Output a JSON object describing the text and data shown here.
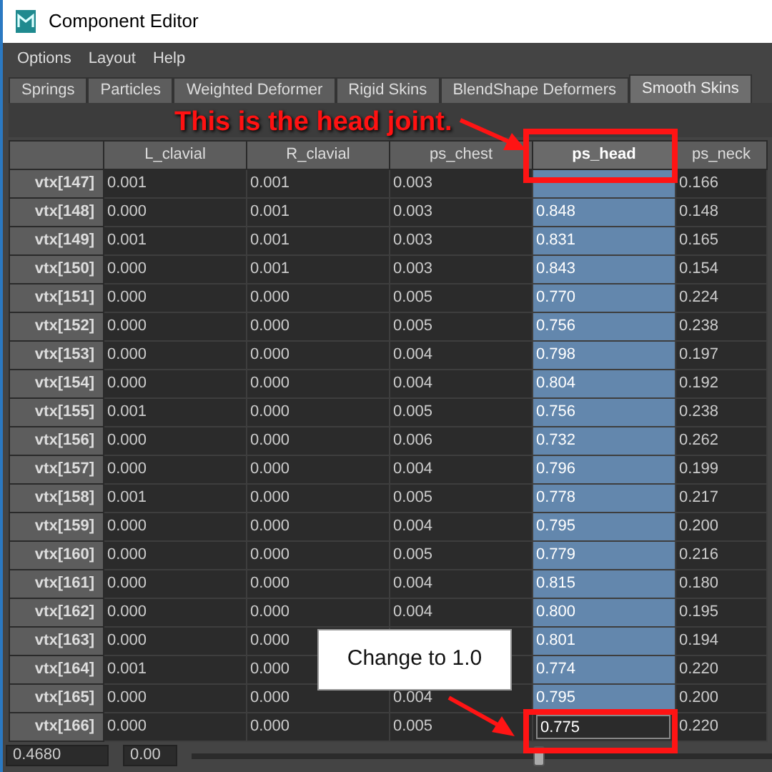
{
  "window": {
    "title": "Component Editor"
  },
  "menu": [
    "Options",
    "Layout",
    "Help"
  ],
  "tabs": [
    {
      "label": "Springs",
      "selected": false
    },
    {
      "label": "Particles",
      "selected": false
    },
    {
      "label": "Weighted Deformer",
      "selected": false
    },
    {
      "label": "Rigid Skins",
      "selected": false
    },
    {
      "label": "BlendShape Deformers",
      "selected": false
    },
    {
      "label": "Smooth Skins",
      "selected": true
    }
  ],
  "table": {
    "columns": [
      {
        "label": "L_clavial",
        "selected": false
      },
      {
        "label": "R_clavial",
        "selected": false
      },
      {
        "label": "ps_chest",
        "selected": false
      },
      {
        "label": "ps_head",
        "selected": true
      },
      {
        "label": "ps_neck",
        "selected": false
      }
    ],
    "rows": [
      {
        "label": "vtx[147]",
        "cells": [
          "0.001",
          "0.001",
          "0.003",
          null,
          "0.166"
        ],
        "editing": false
      },
      {
        "label": "vtx[148]",
        "cells": [
          "0.000",
          "0.001",
          "0.003",
          "0.848",
          "0.148"
        ],
        "editing": false
      },
      {
        "label": "vtx[149]",
        "cells": [
          "0.001",
          "0.001",
          "0.003",
          "0.831",
          "0.165"
        ],
        "editing": false
      },
      {
        "label": "vtx[150]",
        "cells": [
          "0.000",
          "0.001",
          "0.003",
          "0.843",
          "0.154"
        ],
        "editing": false
      },
      {
        "label": "vtx[151]",
        "cells": [
          "0.000",
          "0.000",
          "0.005",
          "0.770",
          "0.224"
        ],
        "editing": false
      },
      {
        "label": "vtx[152]",
        "cells": [
          "0.000",
          "0.000",
          "0.005",
          "0.756",
          "0.238"
        ],
        "editing": false
      },
      {
        "label": "vtx[153]",
        "cells": [
          "0.000",
          "0.000",
          "0.004",
          "0.798",
          "0.197"
        ],
        "editing": false
      },
      {
        "label": "vtx[154]",
        "cells": [
          "0.000",
          "0.000",
          "0.004",
          "0.804",
          "0.192"
        ],
        "editing": false
      },
      {
        "label": "vtx[155]",
        "cells": [
          "0.001",
          "0.000",
          "0.005",
          "0.756",
          "0.238"
        ],
        "editing": false
      },
      {
        "label": "vtx[156]",
        "cells": [
          "0.000",
          "0.000",
          "0.006",
          "0.732",
          "0.262"
        ],
        "editing": false
      },
      {
        "label": "vtx[157]",
        "cells": [
          "0.000",
          "0.000",
          "0.004",
          "0.796",
          "0.199"
        ],
        "editing": false
      },
      {
        "label": "vtx[158]",
        "cells": [
          "0.001",
          "0.000",
          "0.005",
          "0.778",
          "0.217"
        ],
        "editing": false
      },
      {
        "label": "vtx[159]",
        "cells": [
          "0.000",
          "0.000",
          "0.004",
          "0.795",
          "0.200"
        ],
        "editing": false
      },
      {
        "label": "vtx[160]",
        "cells": [
          "0.000",
          "0.000",
          "0.005",
          "0.779",
          "0.216"
        ],
        "editing": false
      },
      {
        "label": "vtx[161]",
        "cells": [
          "0.000",
          "0.000",
          "0.004",
          "0.815",
          "0.180"
        ],
        "editing": false
      },
      {
        "label": "vtx[162]",
        "cells": [
          "0.000",
          "0.000",
          "0.004",
          "0.800",
          "0.195"
        ],
        "editing": false
      },
      {
        "label": "vtx[163]",
        "cells": [
          "0.000",
          "0.000",
          null,
          "0.801",
          "0.194"
        ],
        "editing": false
      },
      {
        "label": "vtx[164]",
        "cells": [
          "0.001",
          "0.000",
          null,
          "0.774",
          "0.220"
        ],
        "editing": false
      },
      {
        "label": "vtx[165]",
        "cells": [
          "0.000",
          "0.000",
          "0.004",
          "0.795",
          "0.200"
        ],
        "editing": false
      },
      {
        "label": "vtx[166]",
        "cells": [
          "0.000",
          "0.000",
          "0.005",
          "0.775",
          "0.220"
        ],
        "editing": true
      }
    ]
  },
  "bottom_bar": {
    "value_field": "0.4680",
    "amount_field": "0.00",
    "slider": {
      "level": 0.6
    }
  },
  "annotations": [
    {
      "kind": "label",
      "text": "This is the head joint."
    },
    {
      "kind": "callout",
      "text": "Change to 1.0"
    }
  ]
}
